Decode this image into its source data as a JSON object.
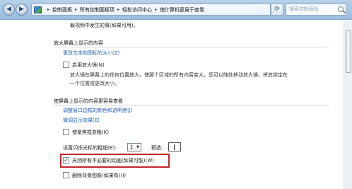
{
  "address_bar": {
    "crumbs": [
      "控制面板",
      "所有控制面板项",
      "轻松访问中心",
      "使计算机更易于查看"
    ],
    "separator": "▸",
    "search_placeholder": "搜索控制面板"
  },
  "content": {
    "top_text": "躲视频中发生的事(如果可用)。",
    "magnify_section": {
      "heading": "放大屏幕上显示的内容",
      "link": "更改文本和图标的大小(Z)",
      "checkbox_label": "启用放大镜(N)",
      "checked": false,
      "desc_line1": "放大镜在屏幕上的任何位置放大，使那个区域的所有内容变大。您可以随处移动放大镜，将其锁定在",
      "desc_line2": "一个位置或更改大小。"
    },
    "easier_section": {
      "heading": "使屏幕上显示的内容更容易查看",
      "link1": "调整窗口边框的颜色和透明度(J)",
      "link2": "微调显示效果(E)",
      "thick_focus_label": "使聚焦框变粗(K)",
      "thick_focus_checked": false,
      "cursor_width_label": "设置闪烁光标的粗细(B):",
      "cursor_width_value": "1",
      "preview_label": "预选:",
      "animations_label": "关闭所有不必要的动画(如果可能)(W)",
      "animations_checked": true,
      "animations_mark": "✓",
      "background_label": "删除背景图像(如果有)(I)",
      "background_checked": false
    }
  },
  "colors": {
    "link": "#1e5fb4",
    "highlight": "#c0282a"
  }
}
